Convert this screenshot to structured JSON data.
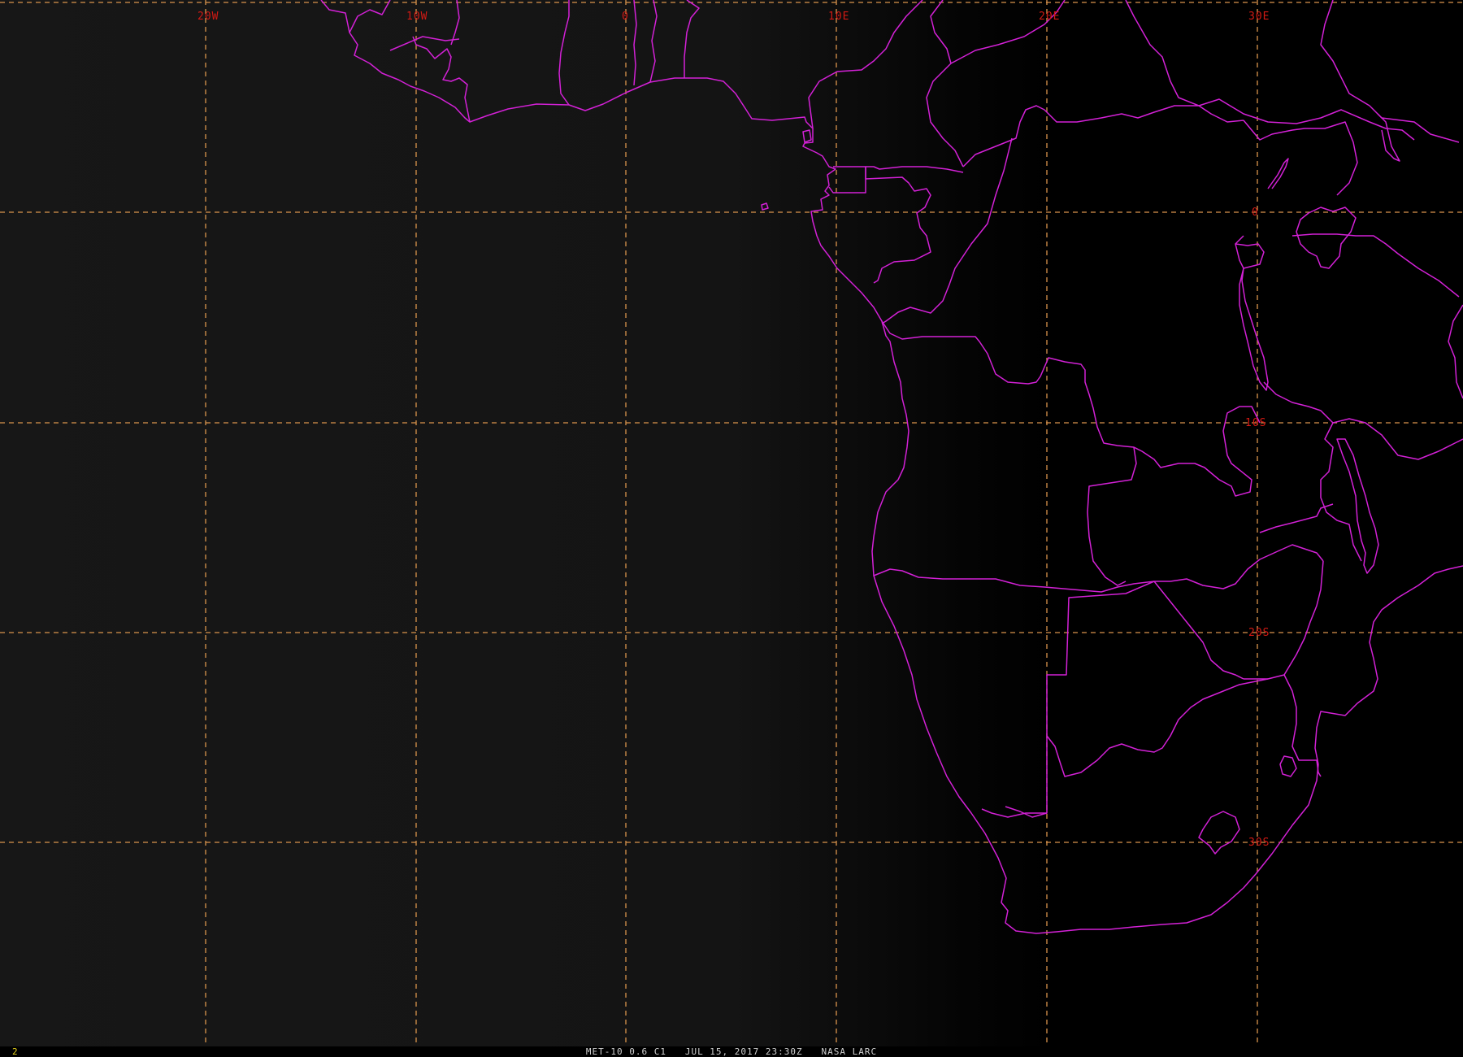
{
  "map": {
    "background_color": "#000000",
    "boundary_color": "#d321d6",
    "grid_color": "#d9944c",
    "grid_label_color": "#d31a14",
    "longitude_labels": [
      "20W",
      "10W",
      "0",
      "10E",
      "20E",
      "30E"
    ],
    "latitude_labels": [
      "0",
      "10S",
      "20S",
      "30S"
    ]
  },
  "status_bar": {
    "frame_number": "2",
    "caption": "MET-10 0.6 C1   JUL 15, 2017 23:30Z   NASA LARC"
  }
}
